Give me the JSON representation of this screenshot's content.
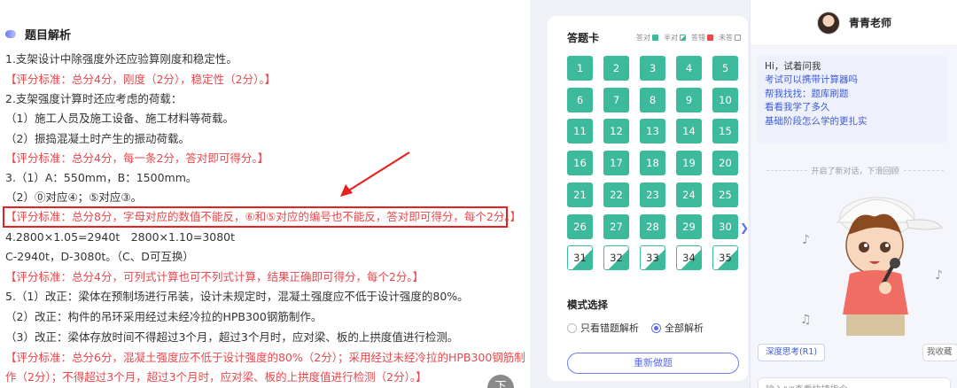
{
  "analysis": {
    "title": "题目解析",
    "lines": [
      {
        "text": "1.支架设计中除强度外还应验算刚度和稳定性。",
        "red": false
      },
      {
        "text": "【评分标准：总分4分，刚度（2分），稳定性（2分）。】",
        "red": true
      },
      {
        "text": "2.支架强度计算时还应考虑的荷载：",
        "red": false
      },
      {
        "text": "（1）施工人员及施工设备、施工材料等荷载。",
        "red": false
      },
      {
        "text": "（2）振捣混凝土时产生的振动荷载。",
        "red": false
      },
      {
        "text": "【评分标准：总分4分，每一条2分，答对即可得分。】",
        "red": true
      },
      {
        "text": "3.（1）A：550mm，B：1500mm。",
        "red": false
      },
      {
        "text": "（2）⓪对应④；⑤对应③。",
        "red": false
      },
      {
        "text": "【评分标准：总分8分，字母对应的数值不能反，⑥和⑤对应的编号也不能反，答对即可得分，每个2分。】",
        "red": true
      },
      {
        "text": "4.2800×1.05=2940t　2800×1.10=3080t",
        "red": false
      },
      {
        "text": "C-2940t，D-3080t。（C、D可互换）",
        "red": false
      },
      {
        "text": "【评分标准：总分4分，可列式计算也可不列式计算，结果正确即可得分，每个2分。】",
        "red": true
      },
      {
        "text": "5.（1）改正：梁体在预制场进行吊装，设计未规定时，混凝土强度应不低于设计强度的80%。",
        "red": false
      },
      {
        "text": "（2）改正：构件的吊环采用经过未经冷拉的HPB300钢筋制作。",
        "red": false
      },
      {
        "text": "（3）改正：梁体存放时间不得超过3个月，超过3个月时，应对梁、板的上拱度值进行检测。",
        "red": false
      },
      {
        "text": "【评分标准：总分6分，混凝土强度应不低于设计强度的80%（2分）；采用经过未经冷拉的HPB300钢筋制",
        "red": true
      },
      {
        "text": "作（2分）；不得超过3个月，超过3个月时，应对梁、板的上拱度值进行检测（2分）。】",
        "red": true
      }
    ],
    "fab_label": "下"
  },
  "answer_card": {
    "title": "答题卡",
    "legend": [
      {
        "label": "答对",
        "color": "#3dba9b"
      },
      {
        "label": "半对",
        "color": "#3dba9b"
      },
      {
        "label": "答错",
        "color": "#e8474b"
      },
      {
        "label": "未答",
        "color": "#ffffff"
      }
    ],
    "questions": [
      {
        "num": "1",
        "status": "correct"
      },
      {
        "num": "2",
        "status": "correct"
      },
      {
        "num": "3",
        "status": "correct"
      },
      {
        "num": "4",
        "status": "correct"
      },
      {
        "num": "5",
        "status": "correct"
      },
      {
        "num": "6",
        "status": "correct"
      },
      {
        "num": "7",
        "status": "correct"
      },
      {
        "num": "8",
        "status": "correct"
      },
      {
        "num": "9",
        "status": "correct"
      },
      {
        "num": "10",
        "status": "correct"
      },
      {
        "num": "11",
        "status": "correct"
      },
      {
        "num": "12",
        "status": "correct"
      },
      {
        "num": "13",
        "status": "correct"
      },
      {
        "num": "14",
        "status": "correct"
      },
      {
        "num": "15",
        "status": "correct"
      },
      {
        "num": "16",
        "status": "correct"
      },
      {
        "num": "17",
        "status": "correct"
      },
      {
        "num": "18",
        "status": "correct"
      },
      {
        "num": "19",
        "status": "correct"
      },
      {
        "num": "20",
        "status": "correct"
      },
      {
        "num": "21",
        "status": "correct"
      },
      {
        "num": "22",
        "status": "correct"
      },
      {
        "num": "23",
        "status": "correct"
      },
      {
        "num": "24",
        "status": "correct"
      },
      {
        "num": "25",
        "status": "correct"
      },
      {
        "num": "26",
        "status": "correct"
      },
      {
        "num": "27",
        "status": "correct"
      },
      {
        "num": "28",
        "status": "correct"
      },
      {
        "num": "29",
        "status": "correct"
      },
      {
        "num": "30",
        "status": "correct"
      },
      {
        "num": "31",
        "status": "half"
      },
      {
        "num": "32",
        "status": "half"
      },
      {
        "num": "33",
        "status": "half"
      },
      {
        "num": "34",
        "status": "half"
      },
      {
        "num": "35",
        "status": "half"
      }
    ],
    "mode_title": "模式选择",
    "mode_options": [
      {
        "label": "只看错题解析",
        "selected": false
      },
      {
        "label": "全部解析",
        "selected": true
      }
    ],
    "redo_label": "重新做题",
    "collapse_icon": "chevron-right-icon"
  },
  "chat": {
    "teacher_name": "青青老师",
    "greeting": "Hi，试着问我",
    "suggestions": [
      "考试可以携带计算器吗",
      "帮我找找：题库刷题",
      "看看我学了多久",
      "基础阶段怎么学的更扎实"
    ],
    "separator": "开启了新对话，下滑回顾",
    "chip_label": "深度思考(R1)",
    "chip2_label": "我收藏",
    "input_placeholder": "输入\"/\"查看快捷指令"
  }
}
